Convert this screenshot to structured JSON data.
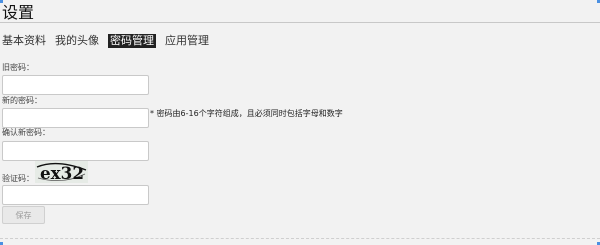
{
  "page": {
    "title": "设置"
  },
  "tabs": [
    {
      "label": "基本资料",
      "active": false
    },
    {
      "label": "我的头像",
      "active": false
    },
    {
      "label": "密码管理",
      "active": true
    },
    {
      "label": "应用管理",
      "active": false
    }
  ],
  "form": {
    "old_password": {
      "label": "旧密码：",
      "value": ""
    },
    "new_password": {
      "label": "新的密码：",
      "value": "",
      "hint": "* 密码由6-16个字符组成，且必须同时包括字母和数字"
    },
    "confirm_password": {
      "label": "确认新密码：",
      "value": ""
    },
    "captcha": {
      "label": "验证码：",
      "image_text": "ex32",
      "value": ""
    },
    "save_label": "保存"
  },
  "colors": {
    "accent": "#4a90e2",
    "active_tab_bg": "#222222",
    "page_bg": "#f2f2f2"
  }
}
